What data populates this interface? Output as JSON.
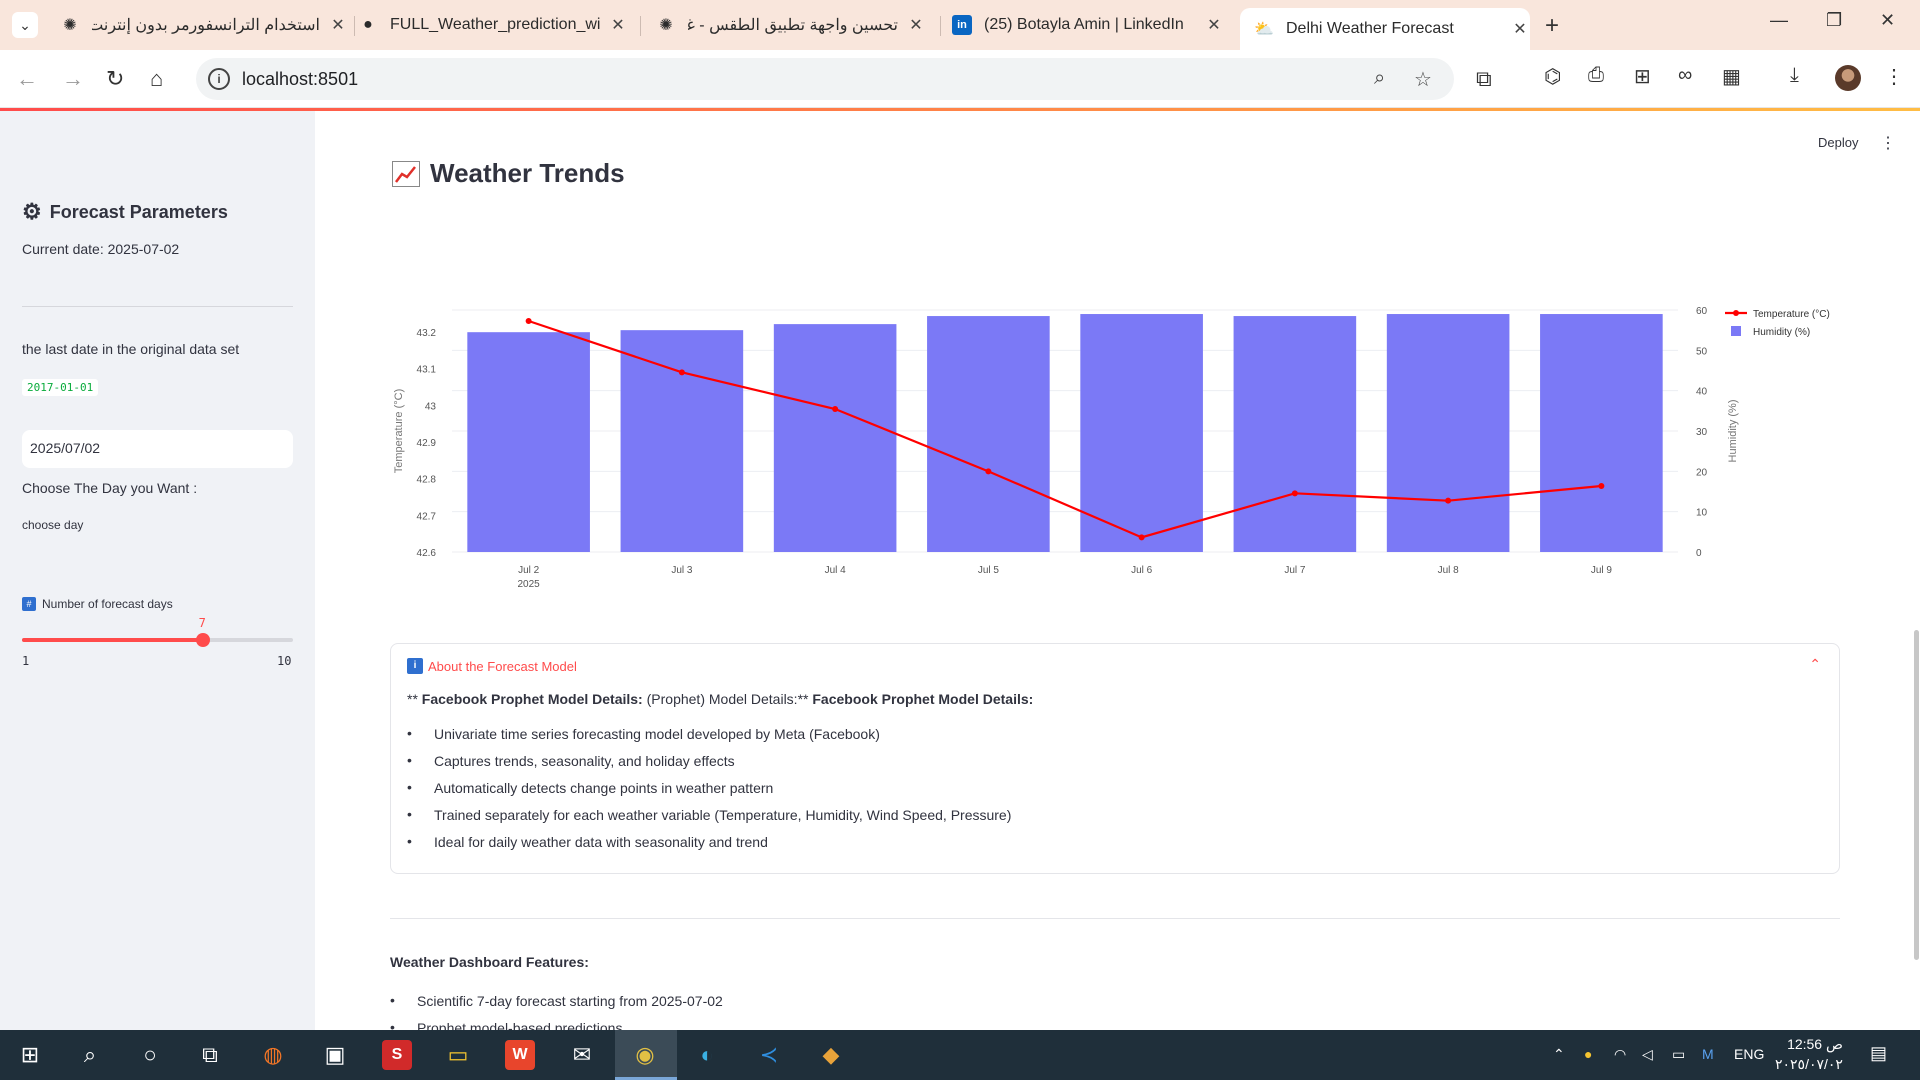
{
  "browser": {
    "tabs": [
      {
        "title": "استخدام الترانسفورمر بدون إنترنت",
        "icon": "openai-icon"
      },
      {
        "title": "FULL_Weather_prediction_with_",
        "icon": "github-icon"
      },
      {
        "title": "تحسين واجهة تطبيق الطقس - غرو",
        "icon": "openai-icon"
      },
      {
        "title": "(25) Botayla Amin | LinkedIn",
        "icon": "linkedin-icon"
      },
      {
        "title": "Delhi Weather Forecast",
        "icon": "weather-icon"
      }
    ],
    "url": "localhost:8501"
  },
  "app": {
    "deploy_label": "Deploy",
    "sidebar": {
      "title": "Forecast Parameters",
      "current_date": "Current date: 2025-07-02",
      "last_date_label": "the last date in the original data set",
      "last_date_value": "2017-01-01",
      "choose_heading": "Choose The Day you Want :",
      "choose_label": "choose day",
      "date_value": "2025/07/02",
      "slider_label": "Number of forecast days",
      "slider_value": "7",
      "slider_min": "1",
      "slider_max": "10",
      "slider_fraction": 0.6667
    },
    "main_title": "Weather Trends",
    "expander": {
      "title": "About the Forecast Model",
      "body_prefix": "** ",
      "body_bold1": "Facebook Prophet Model Details:",
      "body_mid": " (Prophet) Model Details:** ",
      "body_bold2": "Facebook Prophet Model Details:",
      "bullets": [
        "Univariate time series forecasting model developed by Meta (Facebook)",
        "Captures trends, seasonality, and holiday effects",
        "Automatically detects change points in weather pattern",
        "Trained separately for each weather variable (Temperature, Humidity, Wind Speed, Pressure)",
        "Ideal for daily weather data with seasonality and trend"
      ]
    },
    "features": {
      "title": "Weather Dashboard Features:",
      "items": [
        "Scientific 7-day forecast starting from 2025-07-02",
        "Prophet model-based predictions"
      ]
    }
  },
  "chart_data": {
    "type": "bar",
    "categories": [
      "Jul 2",
      "Jul 3",
      "Jul 4",
      "Jul 5",
      "Jul 6",
      "Jul 7",
      "Jul 8",
      "Jul 9"
    ],
    "x_sublabel": "2025",
    "series": [
      {
        "name": "Temperature (°C)",
        "type": "line",
        "axis": "left",
        "color": "#ff0000",
        "values": [
          43.23,
          43.09,
          42.99,
          42.82,
          42.64,
          42.76,
          42.74,
          42.78
        ]
      },
      {
        "name": "Humidity (%)",
        "type": "bar",
        "axis": "right",
        "color": "#7b79f6",
        "values": [
          54.5,
          55,
          56.5,
          58.5,
          59,
          58.5,
          59,
          59
        ]
      }
    ],
    "ylabel": "Temperature (°C)",
    "y2label": "Humidity (%)",
    "yticks": [
      "42.6",
      "42.7",
      "42.8",
      "42.9",
      "43",
      "43.1",
      "43.2"
    ],
    "y2ticks": [
      "0",
      "10",
      "20",
      "30",
      "40",
      "50",
      "60"
    ],
    "ylim": [
      42.6,
      43.26
    ],
    "y2lim": [
      0,
      60
    ],
    "legend": "top-right"
  },
  "taskbar": {
    "lang": "ENG",
    "time": "12:56 ص",
    "date": "٢٠٢٥/٠٧/٠٢"
  }
}
